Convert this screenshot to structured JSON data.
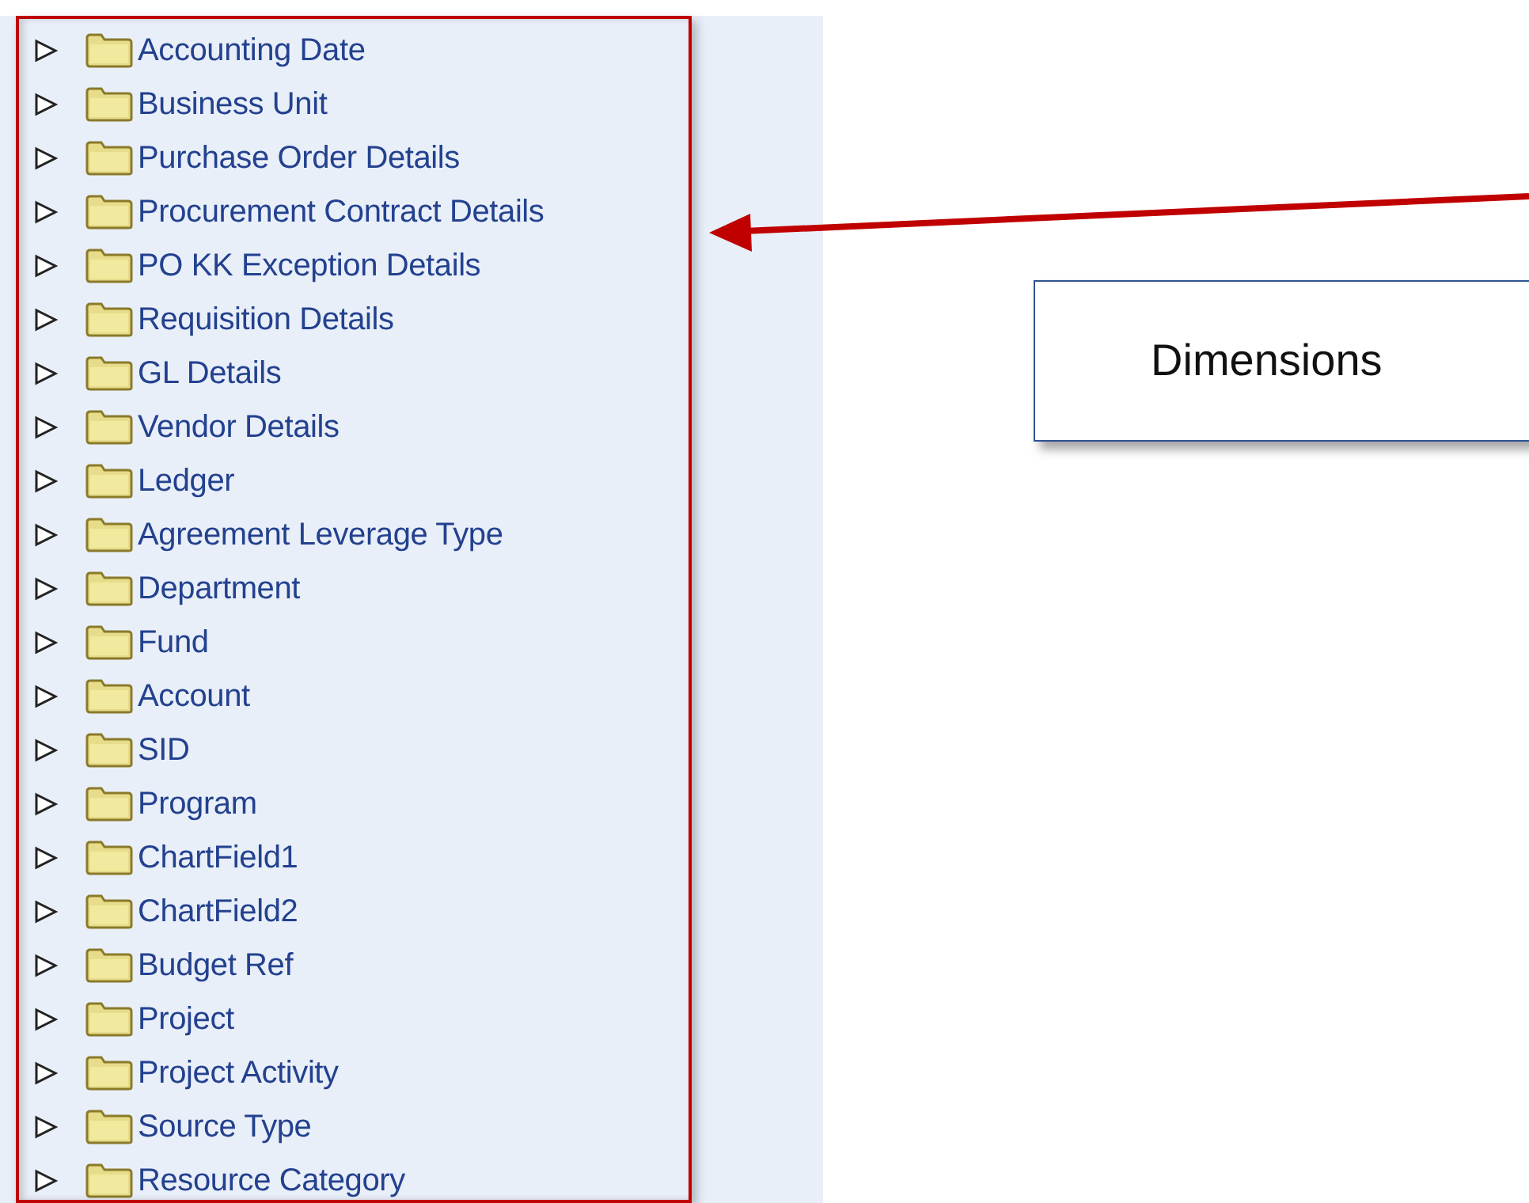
{
  "tree": {
    "items": [
      {
        "label": "Accounting Date",
        "expanded": false
      },
      {
        "label": "Business Unit",
        "expanded": false
      },
      {
        "label": "Purchase Order Details",
        "expanded": false
      },
      {
        "label": "Procurement Contract Details",
        "expanded": false
      },
      {
        "label": "PO KK Exception Details",
        "expanded": false
      },
      {
        "label": "Requisition Details",
        "expanded": false
      },
      {
        "label": "GL Details",
        "expanded": false
      },
      {
        "label": "Vendor Details",
        "expanded": false
      },
      {
        "label": "Ledger",
        "expanded": false
      },
      {
        "label": "Agreement Leverage Type",
        "expanded": false
      },
      {
        "label": "Department",
        "expanded": false
      },
      {
        "label": "Fund",
        "expanded": false
      },
      {
        "label": "Account",
        "expanded": false
      },
      {
        "label": "SID",
        "expanded": false
      },
      {
        "label": "Program",
        "expanded": false
      },
      {
        "label": "ChartField1",
        "expanded": false
      },
      {
        "label": "ChartField2",
        "expanded": false
      },
      {
        "label": "Budget Ref",
        "expanded": false
      },
      {
        "label": "Project",
        "expanded": false
      },
      {
        "label": "Project Activity",
        "expanded": false
      },
      {
        "label": "Source Type",
        "expanded": false
      },
      {
        "label": "Resource Category",
        "expanded": false
      }
    ]
  },
  "callout": {
    "label": "Dimensions"
  }
}
